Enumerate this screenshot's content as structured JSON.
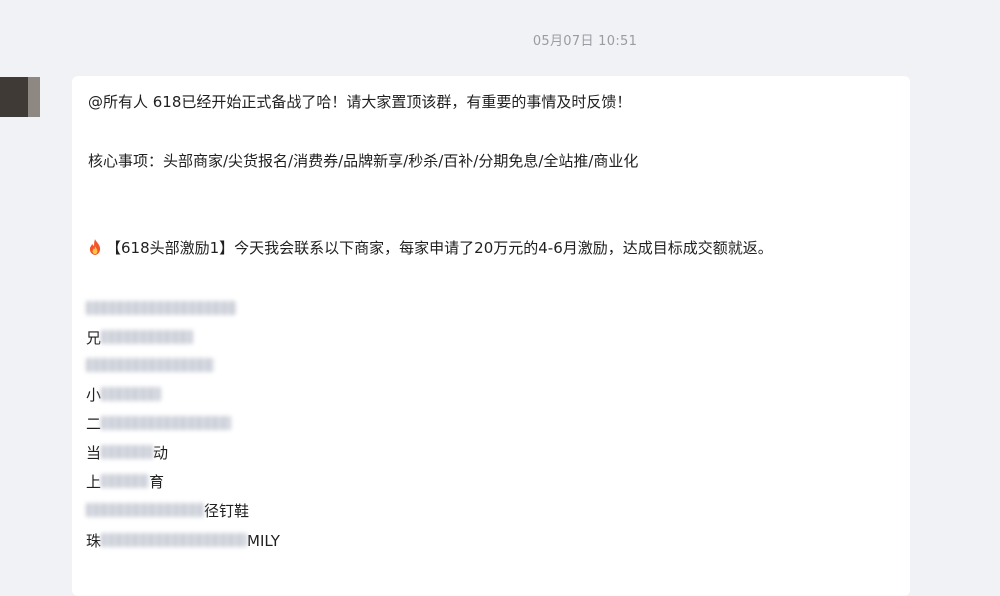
{
  "chat": {
    "timestamp": "05月07日 10:51",
    "message": {
      "line1": "@所有人  618已经开始正式备战了哈！请大家置顶该群，有重要的事情及时反馈！",
      "line2": "核心事项：头部商家/尖货报名/消费券/品牌新享/秒杀/百补/分期免息/全站推/商业化",
      "line3": "【618头部激励1】今天我会联系以下商家，每家申请了20万元的4-6月激励，达成目标成交额就返。",
      "merchants": [
        {
          "prefix": "",
          "suffix": ""
        },
        {
          "prefix": "兄",
          "suffix": ""
        },
        {
          "prefix": "",
          "suffix": ""
        },
        {
          "prefix": "小",
          "suffix": ""
        },
        {
          "prefix": "二",
          "suffix": ""
        },
        {
          "prefix": "当",
          "suffix": "动"
        },
        {
          "prefix": "上",
          "suffix": "育"
        },
        {
          "prefix": "",
          "suffix": "径钉鞋"
        },
        {
          "prefix": "珠",
          "suffix": "MILY"
        }
      ]
    }
  }
}
